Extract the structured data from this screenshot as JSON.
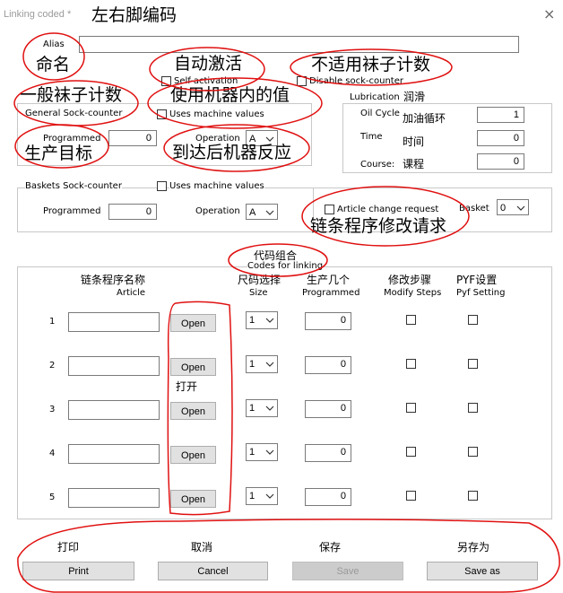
{
  "window": {
    "title": "Linking coded *",
    "title_note": "左右脚编码",
    "close_symbol": "×"
  },
  "alias": {
    "label": "Alias",
    "value": "",
    "note": "命名"
  },
  "self_activation": {
    "label": "Self-activation",
    "note": "自动激活",
    "checked": false
  },
  "disable_sock": {
    "label": "Disable sock-counter",
    "note": "不适用袜子计数",
    "checked": false
  },
  "general": {
    "label": "General Sock-counter",
    "note": "一般袜子计数",
    "uses_machine_values_label": "Uses machine values",
    "uses_machine_values_note": "使用机器内的值",
    "uses_machine_checked": false,
    "programmed_label": "Programmed",
    "programmed_value": "0",
    "programmed_note": "生产目标",
    "operation_label": "Operation",
    "operation_value": "A",
    "operation_note": "到达后机器反应"
  },
  "lubrication": {
    "label": "Lubrication",
    "label_note": "润滑",
    "oil_cycle_label": "Oil Cycle",
    "oil_cycle_note": "加油循环",
    "oil_cycle_value": "1",
    "time_label": "Time",
    "time_note": "时间",
    "time_value": "0",
    "course_label": "Course:",
    "course_note": "课程",
    "course_value": "0"
  },
  "baskets": {
    "label": "Baskets Sock-counter",
    "uses_machine_values_label": "Uses machine values",
    "uses_machine_checked": false,
    "programmed_label": "Programmed",
    "programmed_value": "0",
    "operation_label": "Operation",
    "operation_value": "A",
    "article_change_label": "Article change request",
    "article_change_note": "链条程序修改请求",
    "article_change_checked": false,
    "basket_label": "Basket",
    "basket_value": "0"
  },
  "codes": {
    "label": "Codes for linking",
    "label_note": "代码组合",
    "headers": {
      "article": "Article",
      "article_note": "链条程序名称",
      "size": "Size",
      "size_note": "尺码选择",
      "programmed": "Programmed",
      "programmed_note": "生产几个",
      "modify": "Modify Steps",
      "modify_note": "修改步骤",
      "pyf": "Pyf Setting",
      "pyf_note": "PYF设置"
    },
    "open_note": "打开",
    "rows": [
      {
        "num": "1",
        "article": "",
        "open": "Open",
        "size": "1",
        "programmed": "0"
      },
      {
        "num": "2",
        "article": "",
        "open": "Open",
        "size": "1",
        "programmed": "0"
      },
      {
        "num": "3",
        "article": "",
        "open": "Open",
        "size": "1",
        "programmed": "0"
      },
      {
        "num": "4",
        "article": "",
        "open": "Open",
        "size": "1",
        "programmed": "0"
      },
      {
        "num": "5",
        "article": "",
        "open": "Open",
        "size": "1",
        "programmed": "0"
      }
    ]
  },
  "footer": {
    "print_label": "Print",
    "print_note": "打印",
    "cancel_label": "Cancel",
    "cancel_note": "取消",
    "save_label": "Save",
    "save_note": "保存",
    "saveas_label": "Save as",
    "saveas_note": "另存为"
  }
}
